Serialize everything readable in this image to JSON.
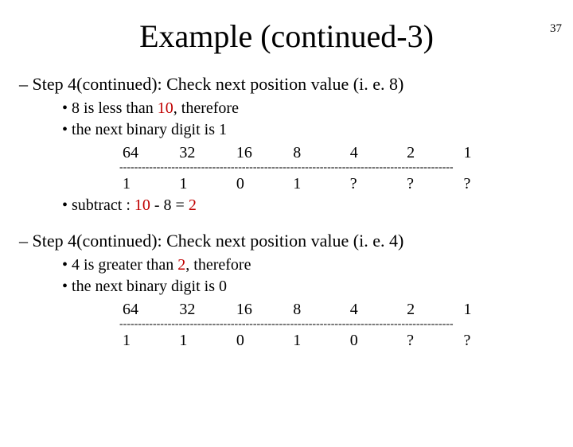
{
  "page_number": "37",
  "title": "Example (continued-3)",
  "sections": [
    {
      "heading": "Step 4(continued): Check next position value (i. e. 8)",
      "bullets": [
        {
          "plain_a": "8 is less than ",
          "hl": "10",
          "plain_b": ", therefore"
        },
        {
          "plain_a": "the next binary digit is 1",
          "hl": "",
          "plain_b": ""
        }
      ],
      "headers": [
        "64",
        "32",
        "16",
        "8",
        "4",
        "2",
        "1"
      ],
      "values": [
        "1",
        "1",
        "0",
        "1",
        "?",
        "?",
        "?"
      ],
      "subtract": {
        "pre": "subtract : ",
        "a": "10",
        "mid": " - 8 = ",
        "b": "2"
      }
    },
    {
      "heading": "Step 4(continued): Check next position value (i. e. 4)",
      "bullets": [
        {
          "plain_a": "4 is greater than ",
          "hl": "2",
          "plain_b": ", therefore"
        },
        {
          "plain_a": "the next binary digit is 0",
          "hl": "",
          "plain_b": ""
        }
      ],
      "headers": [
        "64",
        "32",
        "16",
        "8",
        "4",
        "2",
        "1"
      ],
      "values": [
        "1",
        "1",
        "0",
        "1",
        "0",
        "?",
        "?"
      ],
      "subtract": null
    }
  ],
  "rule": "------------------------------------------------------------------------------------------"
}
